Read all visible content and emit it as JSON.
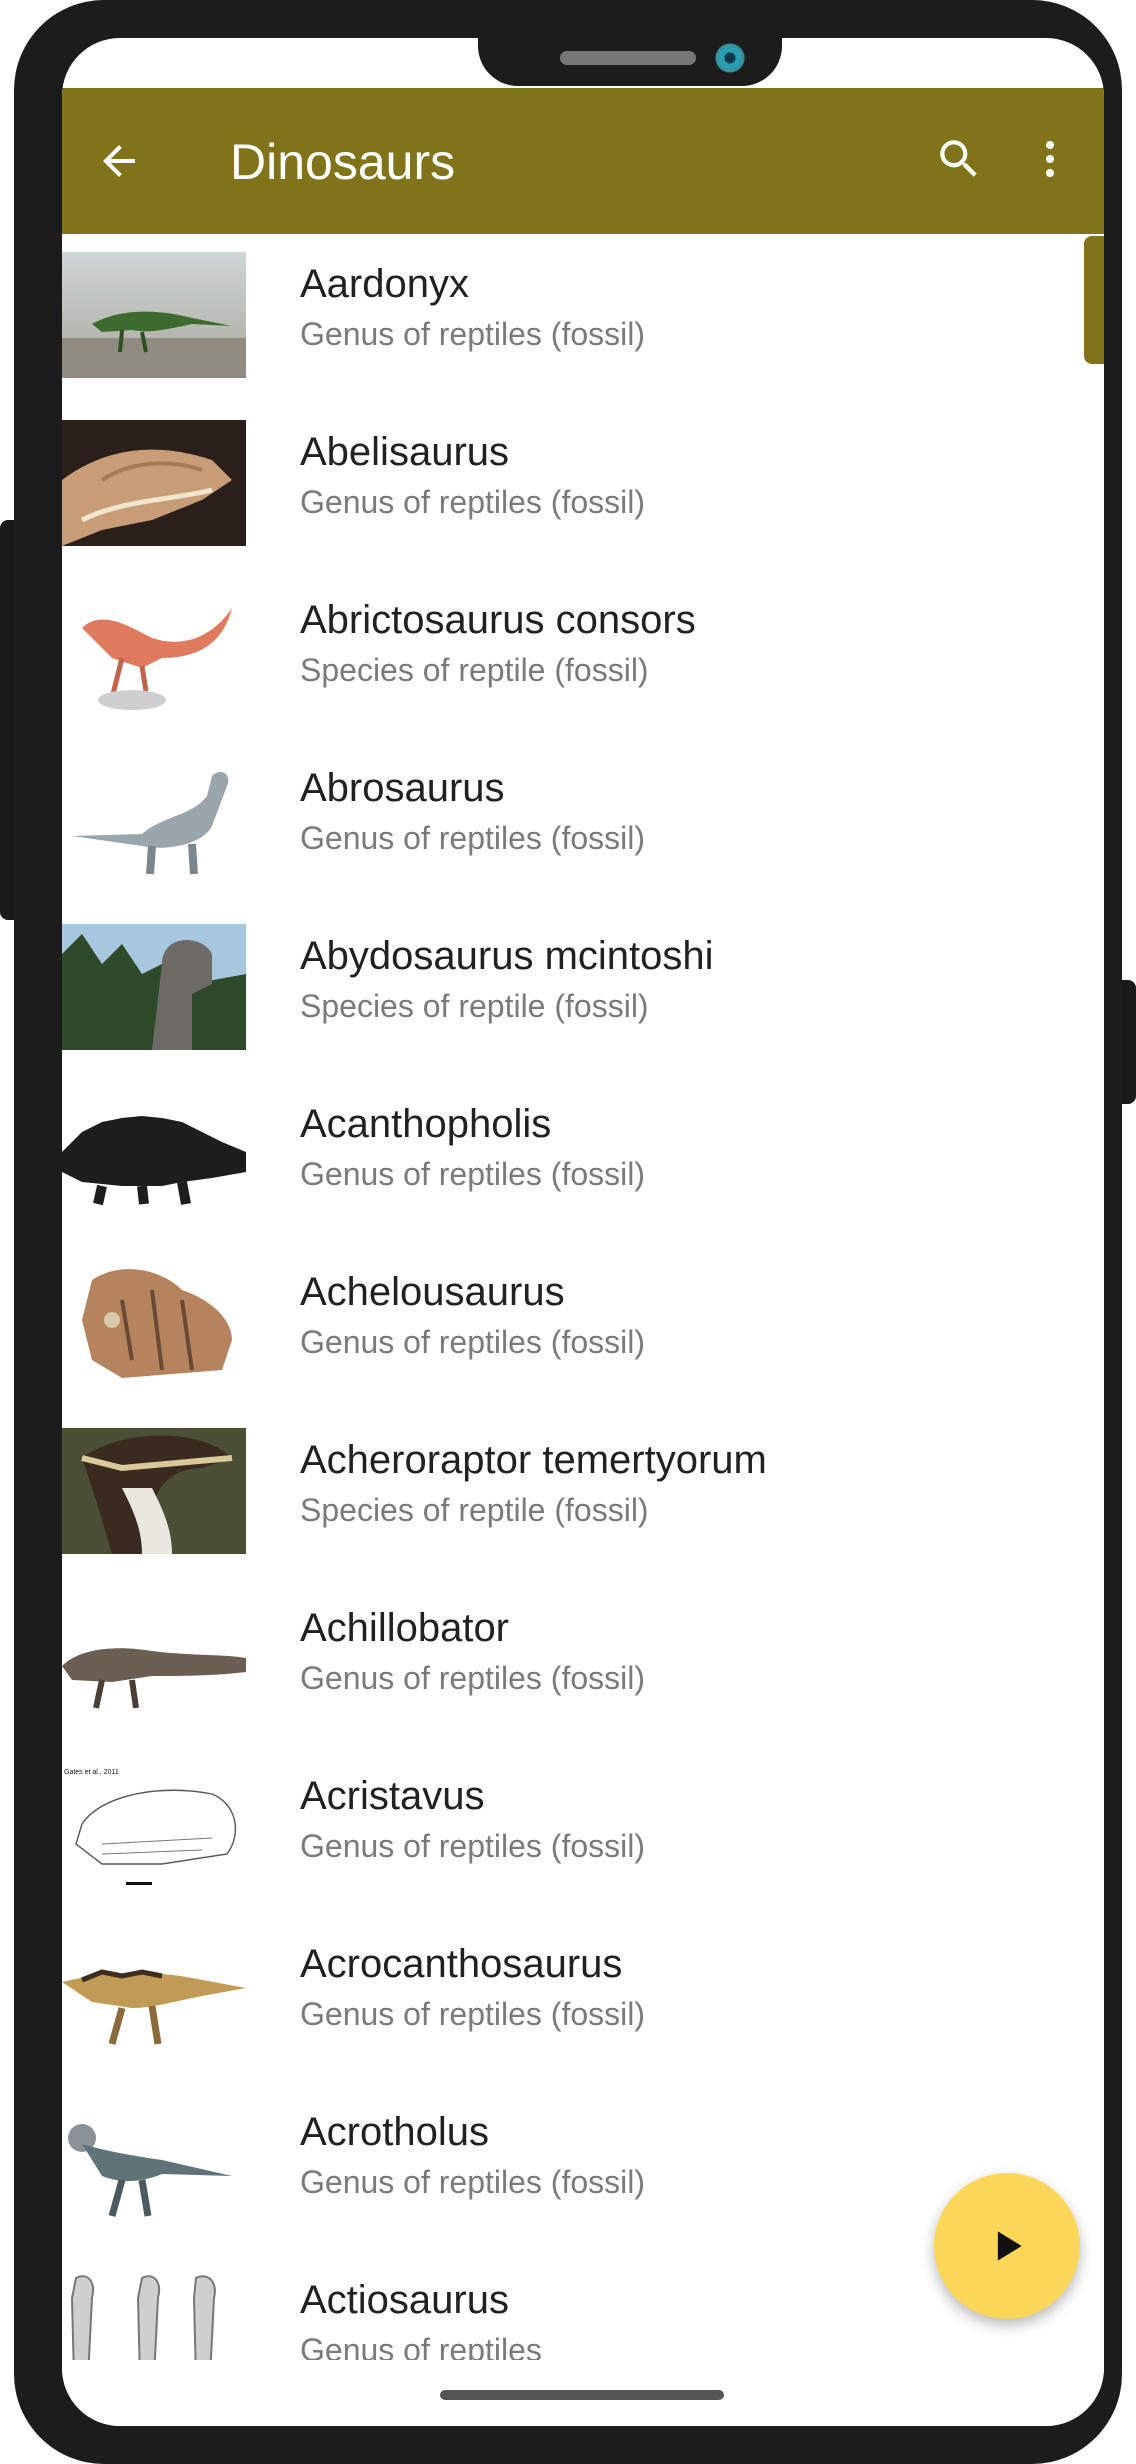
{
  "app": {
    "title": "Dinosaurs",
    "accent_color": "#807319",
    "fab_color": "#fdd75a"
  },
  "toolbar": {
    "back_icon": "arrow-left-icon",
    "search_icon": "search-icon",
    "menu_icon": "more-vertical-icon"
  },
  "fab": {
    "icon": "play-icon"
  },
  "items": [
    {
      "name": "Aardonyx",
      "type": "Genus of reptiles (fossil)"
    },
    {
      "name": "Abelisaurus",
      "type": "Genus of reptiles (fossil)"
    },
    {
      "name": "Abrictosaurus consors",
      "type": "Species of reptile (fossil)"
    },
    {
      "name": "Abrosaurus",
      "type": "Genus of reptiles (fossil)"
    },
    {
      "name": "Abydosaurus mcintoshi",
      "type": "Species of reptile (fossil)"
    },
    {
      "name": "Acanthopholis",
      "type": "Genus of reptiles (fossil)"
    },
    {
      "name": "Achelousaurus",
      "type": "Genus of reptiles (fossil)"
    },
    {
      "name": "Acheroraptor temertyorum",
      "type": "Species of reptile (fossil)"
    },
    {
      "name": "Achillobator",
      "type": "Genus of reptiles (fossil)"
    },
    {
      "name": "Acristavus",
      "type": "Genus of reptiles (fossil)"
    },
    {
      "name": "Acrocanthosaurus",
      "type": "Genus of reptiles (fossil)"
    },
    {
      "name": "Acrotholus",
      "type": "Genus of reptiles (fossil)"
    },
    {
      "name": "Actiosaurus",
      "type": "Genus of reptiles"
    }
  ],
  "thumb_caption": "Gates et al., 2011"
}
